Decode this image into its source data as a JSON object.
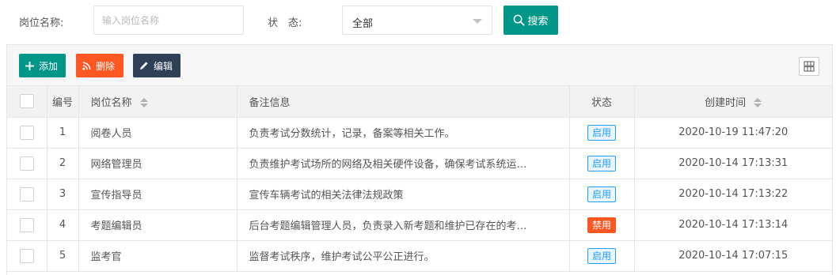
{
  "filters": {
    "position_label": "岗位名称:",
    "position_placeholder": "输入岗位名称",
    "status_label": "状　态:",
    "status_value": "全部",
    "search_label": "搜索"
  },
  "toolbar": {
    "add_label": "添加",
    "delete_label": "删除",
    "edit_label": "编辑"
  },
  "table": {
    "headers": {
      "num": "编号",
      "name": "岗位名称",
      "note": "备注信息",
      "status": "状态",
      "created": "创建时间"
    },
    "rows": [
      {
        "num": "1",
        "name": "阅卷人员",
        "note": "负责考试分数统计，记录，备案等相关工作。",
        "status": "启用",
        "created": "2020-10-19 11:47:20"
      },
      {
        "num": "2",
        "name": "网络管理员",
        "note": "负责维护考试场所的网络及相关硬件设备，确保考试系统运…",
        "status": "启用",
        "created": "2020-10-14 17:13:31"
      },
      {
        "num": "3",
        "name": "宣传指导员",
        "note": "宣传车辆考试的相关法律法规政策",
        "status": "启用",
        "created": "2020-10-14 17:13:22"
      },
      {
        "num": "4",
        "name": "考题编辑员",
        "note": "后台考题编辑管理人员，负责录入新考题和维护已存在的考…",
        "status": "禁用",
        "created": "2020-10-14 17:13:14"
      },
      {
        "num": "5",
        "name": "监考官",
        "note": "监督考试秩序，维护考试公平公正进行。",
        "status": "启用",
        "created": "2020-10-14 17:07:15"
      }
    ]
  },
  "colors": {
    "primary": "#009688",
    "danger": "#ff5722",
    "dark": "#2f4056",
    "enabled_badge": "#1e9fff",
    "disabled_badge": "#ff5722"
  }
}
